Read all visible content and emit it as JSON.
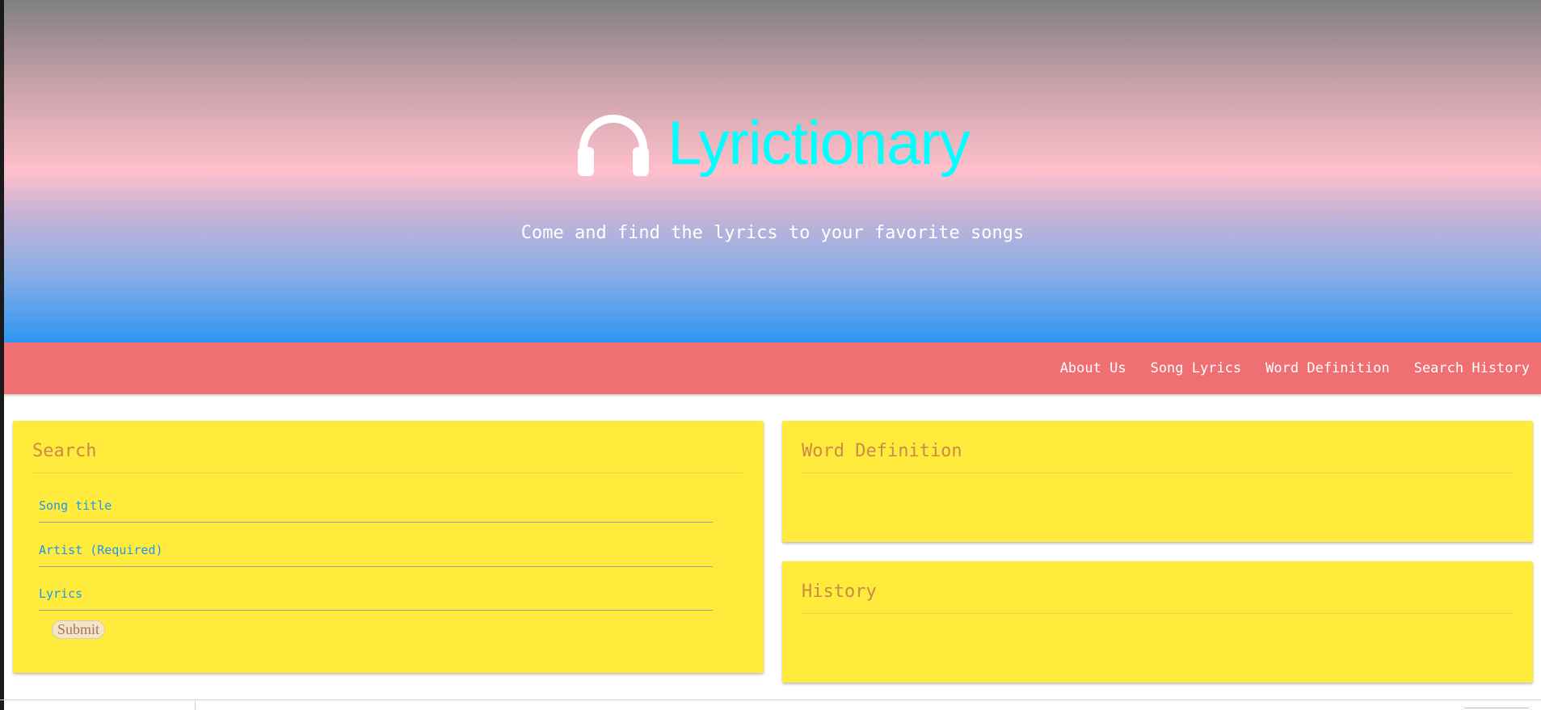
{
  "header": {
    "brand_name": "Lyrictionary",
    "brand_icon": "headphones-icon",
    "tagline": "Come and find the lyrics to your favorite songs"
  },
  "nav": {
    "items": [
      {
        "label": "About Us"
      },
      {
        "label": "Song Lyrics"
      },
      {
        "label": "Word Definition"
      },
      {
        "label": "Search History"
      }
    ]
  },
  "search_card": {
    "title": "Search",
    "song_title_placeholder": "Song title",
    "artist_placeholder": "Artist (Required)",
    "lyrics_placeholder": "Lyrics",
    "submit_label": "Submit"
  },
  "word_card": {
    "title": "Word Definition"
  },
  "history_card": {
    "title": "History"
  },
  "colors": {
    "brand_text": "#00ffff",
    "navbar_bg": "#ef6f73",
    "card_bg": "#ffeb3b",
    "card_title": "#c98a4a",
    "placeholder": "#2196f3"
  }
}
